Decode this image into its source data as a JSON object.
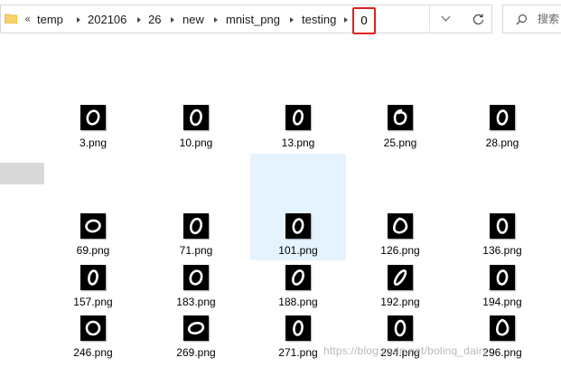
{
  "address": {
    "overflow": "«",
    "crumbs": [
      "temp",
      "202106",
      "26",
      "new",
      "mnist_png",
      "testing"
    ],
    "current": "0"
  },
  "search": {
    "placeholder": "搜索"
  },
  "files": [
    {
      "name": "3.png"
    },
    {
      "name": "10.png"
    },
    {
      "name": "13.png"
    },
    {
      "name": "25.png"
    },
    {
      "name": "28.png"
    },
    {
      "name": "69.png"
    },
    {
      "name": "71.png"
    },
    {
      "name": "101.png"
    },
    {
      "name": "126.png"
    },
    {
      "name": "136.png"
    },
    {
      "name": "157.png"
    },
    {
      "name": "183.png"
    },
    {
      "name": "188.png"
    },
    {
      "name": "192.png"
    },
    {
      "name": "194.png"
    },
    {
      "name": "246.png"
    },
    {
      "name": "269.png"
    },
    {
      "name": "271.png"
    },
    {
      "name": "294.png"
    },
    {
      "name": "296.png"
    }
  ],
  "selected_file": "101.png",
  "watermark": "https://blog.csdn.net/bolinq_dairy",
  "colors": {
    "highlight_box": "#e02020",
    "selection": "#e5f3ff"
  }
}
